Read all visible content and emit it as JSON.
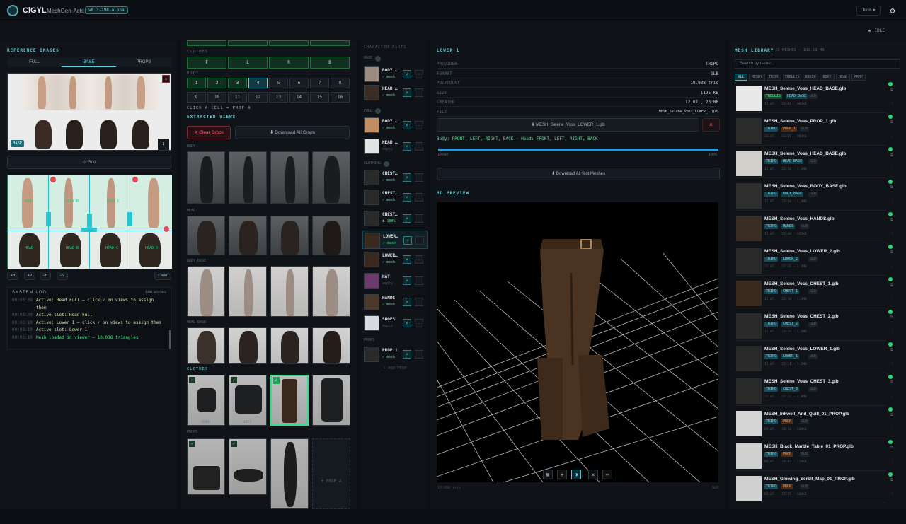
{
  "app": {
    "brand": "CiGYL",
    "subtitle": "MeshGen-Actor",
    "version": "v0.3-198-alpha",
    "tools": "Tools",
    "status": "IDLE"
  },
  "ref": {
    "title": "REFERENCE IMAGES",
    "tabs": [
      "FULL",
      "BASE",
      "PROPS"
    ],
    "badge": "BASE",
    "grid": "⊹ Grid",
    "grid_buttons": [
      "+H",
      "+V",
      "−H",
      "−V"
    ],
    "clear": "Clear",
    "labels": [
      "BODY",
      "BODY B",
      "BODY C",
      "HEAD",
      "HEAD B",
      "HEAD C",
      "HEAD D"
    ]
  },
  "log": {
    "title": "SYSTEM LOG",
    "count": "606 entries",
    "lines": [
      {
        "t": "00:03:09",
        "m": "Active: Head Full — click ✓ on views to assign"
      },
      {
        "t": "",
        "m": "them"
      },
      {
        "t": "00:03:09",
        "m": "Active slot: Head Full"
      },
      {
        "t": "00:03:10",
        "m": "Active: Lower 1 — click ✓ on views to assign them"
      },
      {
        "t": "00:03:10",
        "m": "Active slot: Lower 1"
      },
      {
        "t": "00:03:10",
        "m": "Mesh loaded in viewer — 10.038 triangles"
      }
    ]
  },
  "mid": {
    "clothes_label": "CLOTHES",
    "clothes_cells": [
      "F",
      "L",
      "R",
      "B"
    ],
    "body_label": "BODY",
    "grid_row1": [
      "1",
      "2",
      "3",
      "4",
      "5",
      "6",
      "7",
      "8"
    ],
    "grid_row2": [
      "9",
      "10",
      "11",
      "12",
      "13",
      "14",
      "15",
      "16"
    ],
    "hint": "CLICK A CELL → PROP A",
    "extracted": "EXTRACTED VIEWS",
    "clear_crops": "✕ Clear Crops",
    "download_crops": "⬇ Download All Crops",
    "sec_body": "BODY",
    "sec_head": "HEAD",
    "sec_body_base": "BODY BASE",
    "sec_head_base": "HEAD BASE",
    "sec_clothes": "CLOTHES",
    "sec_props": "PROPS",
    "cap_front": "FRONT",
    "cap_left": "LEFT",
    "prop_add": "+ PROP A"
  },
  "parts": {
    "title": "CHARACTER PARTS",
    "groups": [
      "BASE",
      "FULL",
      "CLOTHING",
      "PROPS"
    ],
    "slots": [
      {
        "n": "BODY …",
        "s": "✓ mesh"
      },
      {
        "n": "HEAD …",
        "s": "✓ mesh"
      },
      {
        "n": "BODY …",
        "s": "✓ mesh"
      },
      {
        "n": "HEAD …",
        "s": "empty"
      },
      {
        "n": "CHEST…",
        "s": "✓ mesh"
      },
      {
        "n": "CHEST…",
        "s": "✓ mesh"
      },
      {
        "n": "CHEST…",
        "s": "⧗ 100%"
      },
      {
        "n": "LOWER…",
        "s": "✓ mesh"
      },
      {
        "n": "LOWER…",
        "s": "✓ mesh"
      },
      {
        "n": "HAT",
        "s": "empty"
      },
      {
        "n": "HANDS",
        "s": "✓ mesh"
      },
      {
        "n": "SHOES",
        "s": "empty"
      },
      {
        "n": "PROP 1",
        "s": "✓ mesh"
      }
    ],
    "add": "+ ADD PROP"
  },
  "detail": {
    "title": "LOWER 1",
    "rows": [
      [
        "PROVIDER",
        "TRIPO"
      ],
      [
        "FORMAT",
        "GLB"
      ],
      [
        "POLYCOUNT",
        "10.038 tris"
      ],
      [
        "SIZE",
        "1195 KB"
      ],
      [
        "CREATED",
        "12.07., 23:06"
      ],
      [
        "FILE",
        "MESH_Selene_Voss_LOWER_1.glb"
      ]
    ],
    "download": "⬇ MESH_Selene_Voss_LOWER_1.glb",
    "views": "Body: FRONT, LEFT, RIGHT, BACK · Head: FRONT, LEFT, RIGHT, BACK",
    "done": "Done!",
    "pct": "100%",
    "progress": 1.0,
    "download_all": "⬇ Download All Slot Meshes",
    "preview": "3D PREVIEW",
    "footer_l": "10.038 tris",
    "footer_r": "GLB"
  },
  "library": {
    "title": "MESH LIBRARY",
    "meta": "19 MESHES · 102.19 MB",
    "search_placeholder": "Search by name...",
    "filters": [
      "ALL",
      "MESHY",
      "TRIPO",
      "TRELLIS",
      "RODIN",
      "BODY",
      "HEAD",
      "PROP"
    ],
    "items": [
      {
        "name": "MESH_Selene_Voss_HEAD_BASE.glb",
        "p": "TRELLIS",
        "s": "HEAD_BASE",
        "f": "GLB",
        "m": "12.07. · 23:01 · 882KB"
      },
      {
        "name": "MESH_Selene_Voss_PROP_1.glb",
        "p": "TRIPO",
        "s": "PROP_1",
        "f": "GLB",
        "m": "12.07. · 23:01 · 802KB"
      },
      {
        "name": "MESH_Selene_Voss_HEAD_BASE.glb",
        "p": "TRIPO",
        "s": "HEAD_BASE",
        "f": "GLB",
        "m": "12.07. · 22:58 · 1.1MB"
      },
      {
        "name": "MESH_Selene_Voss_BODY_BASE.glb",
        "p": "TRIPO",
        "s": "BODY_BASE",
        "f": "GLB",
        "m": "12.07. · 22:54 · 1.4MB"
      },
      {
        "name": "MESH_Selene_Voss_HANDS.glb",
        "p": "TRIPO",
        "s": "HANDS",
        "f": "GLB",
        "m": "12.07. · 22:48 · 912KB"
      },
      {
        "name": "MESH_Selene_Voss_LOWER_2.glb",
        "p": "TRIPO",
        "s": "LOWER_2",
        "f": "GLB",
        "m": "12.07. · 22:41 · 1.2MB"
      },
      {
        "name": "MESH_Selene_Voss_CHEST_1.glb",
        "p": "TRIPO",
        "s": "CHEST_1",
        "f": "GLB",
        "m": "12.07. · 22:38 · 1.3MB"
      },
      {
        "name": "MESH_Selene_Voss_CHEST_2.glb",
        "p": "TRIPO",
        "s": "CHEST_2",
        "f": "GLB",
        "m": "12.07. · 22:35 · 1.1MB"
      },
      {
        "name": "MESH_Selene_Voss_LOWER_1.glb",
        "p": "TRIPO",
        "s": "LOWER_1",
        "f": "GLB",
        "m": "12.07. · 22:31 · 1.2MB"
      },
      {
        "name": "MESH_Selene_Voss_CHEST_3.glb",
        "p": "TRIPO",
        "s": "CHEST_3",
        "f": "GLB",
        "m": "12.07. · 22:27 · 1.0MB"
      },
      {
        "name": "MESH_Inkwell_And_Quill_01_PROP.glb",
        "p": "TRIPO",
        "s": "PROP",
        "f": "GLB",
        "m": "09.07. · 18:10 · 640KB"
      },
      {
        "name": "MESH_Black_Marble_Table_01_PROP.glb",
        "p": "TRIPO",
        "s": "PROP",
        "f": "GLB",
        "m": "09.07. · 18:02 · 720KB"
      },
      {
        "name": "MESH_Glowing_Scroll_Map_01_PROP.glb",
        "p": "TRIPO",
        "s": "PROP",
        "f": "GLB",
        "m": "09.07. · 17:55 · 680KB"
      }
    ]
  }
}
